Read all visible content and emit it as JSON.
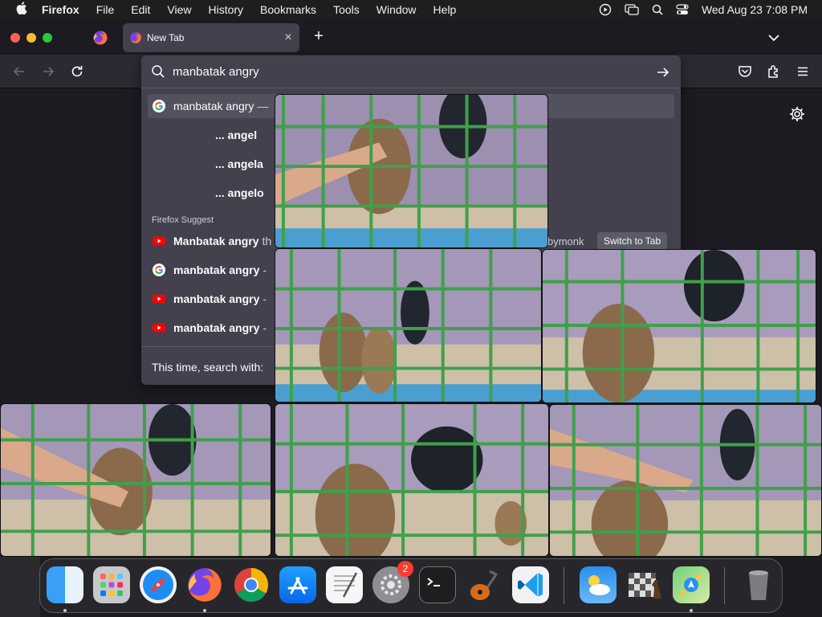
{
  "menubar": {
    "app_name": "Firefox",
    "items": [
      "File",
      "Edit",
      "View",
      "History",
      "Bookmarks",
      "Tools",
      "Window",
      "Help"
    ],
    "clock": "Wed Aug 23  7:08 PM"
  },
  "tabs": {
    "active_title": "New Tab",
    "close_label": "×",
    "new_tab_label": "+"
  },
  "urlbar": {
    "query": "manbatak angry",
    "results": [
      {
        "text": "manbatak angry",
        "suffix": "—",
        "icon": "google-icon"
      },
      {
        "text": "... angel"
      },
      {
        "text": "... angela"
      },
      {
        "text": "... angelo"
      }
    ],
    "group_label": "Firefox Suggest",
    "suggest_results": [
      {
        "text": "Manbatak angry",
        "suffix": "th",
        "icon": "youtube-icon"
      },
      {
        "text": "manbatak angry",
        "suffix": "-",
        "icon": "google-icon"
      },
      {
        "text": "manbatak angry",
        "suffix": "-",
        "icon": "youtube-icon"
      },
      {
        "text": "manbatak angry",
        "suffix": "-",
        "icon": "youtube-icon"
      }
    ],
    "partial_url": "bymonk",
    "switch_to_tab": "Switch to Tab",
    "oneoff_label": "This time, search with:"
  },
  "dock": {
    "apps": [
      "finder-icon",
      "launchpad-icon",
      "safari-icon",
      "firefox-icon",
      "chrome-icon",
      "app-store-icon",
      "textedit-icon",
      "system-settings-icon",
      "terminal-icon",
      "garageband-icon",
      "vscode-icon",
      "weather-icon",
      "chess-icon",
      "maps-icon",
      "trash-icon"
    ],
    "settings_badge": "2"
  },
  "colors": {
    "accent": "#42414d",
    "close": "#ff5f57",
    "minimize": "#febc2e",
    "zoom": "#28c840",
    "badge": "#ff3b30"
  }
}
